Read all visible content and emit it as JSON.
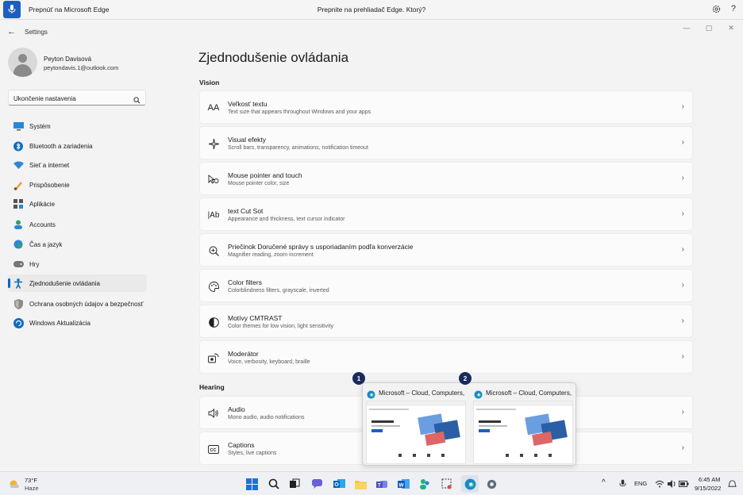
{
  "voice_bar": {
    "left_text": "Prepnúť na Microsoft Edge",
    "center_text": "Prepnite na prehliadač Edge. Ktorý?"
  },
  "window": {
    "title": "Settings"
  },
  "user": {
    "name": "Peyton Davisová",
    "email": "peytondavis.1@outlook.com"
  },
  "search": {
    "value": "Ukončenie nastavenia"
  },
  "sidebar": {
    "items": [
      {
        "label": "Systém",
        "icon": "monitor-icon"
      },
      {
        "label": "Bluetooth a zariadenia",
        "icon": "bluetooth-icon"
      },
      {
        "label": "Sieť a internet",
        "icon": "wifi-icon"
      },
      {
        "label": "Prispôsobenie",
        "icon": "brush-icon"
      },
      {
        "label": "Aplikácie",
        "icon": "apps-icon"
      },
      {
        "label": "Accounts",
        "icon": "person-icon"
      },
      {
        "label": "Čas a jazyk",
        "icon": "globe-clock-icon"
      },
      {
        "label": "Hry",
        "icon": "gamepad-icon"
      },
      {
        "label": "Zjednodušenie ovládania",
        "icon": "accessibility-icon",
        "active": true
      },
      {
        "label": "Ochrana osobných údajov a bezpečnosť",
        "icon": "shield-icon"
      },
      {
        "label": "Windows Aktualizácia",
        "icon": "update-icon"
      }
    ]
  },
  "main": {
    "title": "Zjednodušenie ovládania",
    "sections": [
      {
        "title": "Vision"
      },
      {
        "title": "Hearing"
      }
    ],
    "cards": [
      {
        "title": "Veľkosť textu",
        "subtitle": "Text size that appears throughout Windows and your apps",
        "icon": "text-size-icon"
      },
      {
        "title": "Visual efekty",
        "subtitle": "Scroll bars, transparency, animations, notification timeout",
        "icon": "sparkle-icon"
      },
      {
        "title": "Mouse pointer and touch",
        "subtitle": "Mouse pointer color, size",
        "icon": "pointer-icon"
      },
      {
        "title": "text Cut Sot",
        "subtitle": "Appearance and thickness, text cursor indicator",
        "icon": "text-cursor-icon"
      },
      {
        "title": "Priečinok Doručené správy s usporiadaním podľa konverzácie",
        "subtitle": "Magnifier reading, zoom increment",
        "icon": "magnifier-icon"
      },
      {
        "title": "Color filters",
        "subtitle": "Colorblindness filters, grayscale, inverted",
        "icon": "palette-icon"
      },
      {
        "title": "Motívy CMTRAST",
        "subtitle": "Color themes for low vision, light sensitivity",
        "icon": "contrast-icon"
      },
      {
        "title": "Moderátor",
        "subtitle": "Voice, verbosity, keyboard, braille",
        "icon": "narrator-icon"
      },
      {
        "title": "Audio",
        "subtitle": "Mono audio, audio notifications",
        "icon": "speaker-icon"
      },
      {
        "title": "Captions",
        "subtitle": "Styles, live captions",
        "icon": "captions-icon"
      }
    ]
  },
  "preview": {
    "windows": [
      {
        "number": "1",
        "title": "Microsoft – Cloud, Computers, ..."
      },
      {
        "number": "2",
        "title": "Microsoft – Cloud, Computers, ..."
      }
    ]
  },
  "taskbar": {
    "weather_temp": "73°F",
    "weather_desc": "Haze",
    "language": "ENG",
    "time": "6:45 AM",
    "date": "9/15/2022"
  },
  "colors": {
    "accent": "#0067c0",
    "badge": "#1a2a5c",
    "voice_mic": "#1d5fbf"
  }
}
